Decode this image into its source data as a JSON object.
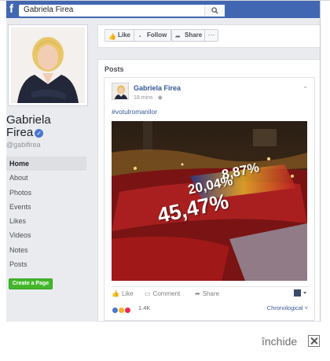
{
  "search": {
    "value": "Gabriela Firea"
  },
  "page": {
    "name_line1": "Gabriela",
    "name_line2": "Firea",
    "handle": "@gabifirea"
  },
  "nav": [
    {
      "label": "Home",
      "active": true
    },
    {
      "label": "About"
    },
    {
      "label": "Photos"
    },
    {
      "label": "Events"
    },
    {
      "label": "Likes"
    },
    {
      "label": "Videos"
    },
    {
      "label": "Notes"
    },
    {
      "label": "Posts"
    }
  ],
  "create_page_label": "Create a Page",
  "action_bar": {
    "like": "Like",
    "follow": "Follow",
    "share": "Share",
    "more": "···"
  },
  "posts": {
    "title": "Posts",
    "post": {
      "author": "Gabriela Firea",
      "time": "18 mins",
      "hashtag": "#votulromanilor",
      "image_text": [
        "8,87%",
        "20,04%",
        "45,47%"
      ],
      "actions": {
        "like": "Like",
        "comment": "Comment",
        "share": "Share"
      },
      "reaction_count": "1.4K",
      "sort_label": "Chronological ˅"
    }
  },
  "close_label": "închide",
  "colors": {
    "brand": "#4267b2",
    "link": "#365899",
    "create_btn": "#42b72a"
  }
}
